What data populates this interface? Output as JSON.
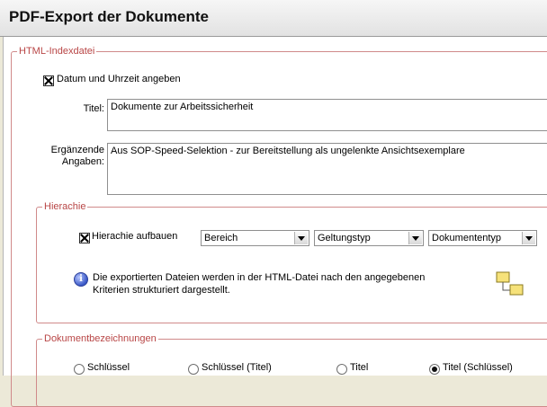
{
  "dialog": {
    "title": "PDF-Export der Dokumente"
  },
  "html_index": {
    "legend": "HTML-Indexdatei",
    "datetime_label": "Datum und Uhrzeit angeben",
    "title_label": "Titel:",
    "title_value": "Dokumente zur Arbeitssicherheit",
    "extra_label_1": "Ergänzende",
    "extra_label_2": "Angaben:",
    "extra_value": "Aus SOP-Speed-Selektion - zur Bereitstellung als ungelenkte Ansichtsexemplare"
  },
  "hierarchy": {
    "legend": "Hierachie",
    "build_label": "Hierachie aufbauen",
    "combo1": "Bereich",
    "combo2": "Geltungstyp",
    "combo3": "Dokumententyp",
    "info_line1": "Die exportierten Dateien werden in der HTML-Datei nach den angegebenen",
    "info_line2": "Kriterien strukturiert dargestellt."
  },
  "doc_names": {
    "legend": "Dokumentbezeichnungen",
    "options": [
      "Schlüssel",
      "Schlüssel (Titel)",
      "Titel",
      "Titel (Schlüssel)"
    ],
    "selected": "Titel (Schlüssel)"
  }
}
